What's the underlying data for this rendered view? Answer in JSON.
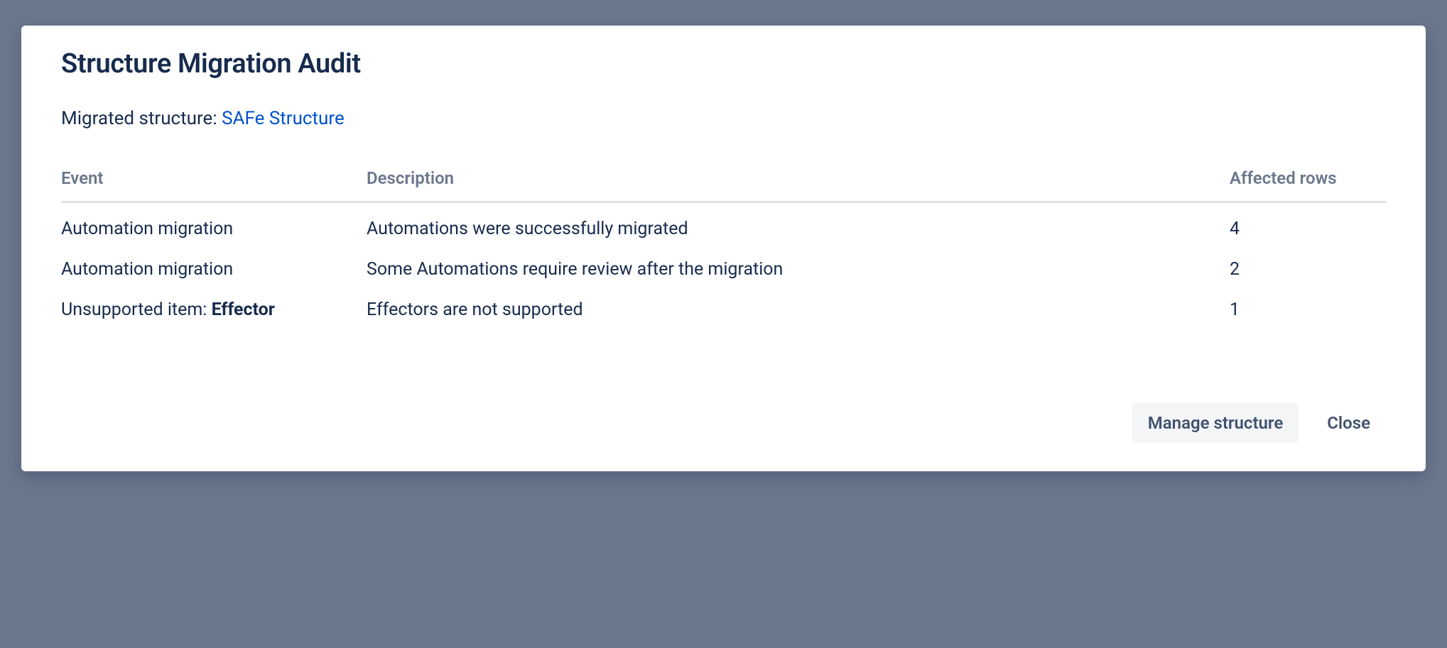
{
  "modal": {
    "title": "Structure Migration Audit",
    "subheading_label": "Migrated structure: ",
    "structure_link_text": "SAFe Structure"
  },
  "table": {
    "headers": {
      "event": "Event",
      "description": "Description",
      "affected": "Affected rows"
    },
    "rows": [
      {
        "event_prefix": "Automation migration",
        "event_bold": "",
        "description": "Automations were successfully migrated",
        "affected": "4"
      },
      {
        "event_prefix": "Automation migration",
        "event_bold": "",
        "description": "Some Automations require review after the migration",
        "affected": "2"
      },
      {
        "event_prefix": "Unsupported item: ",
        "event_bold": "Effector",
        "description": "Effectors are not supported",
        "affected": "1"
      }
    ]
  },
  "footer": {
    "manage_button": "Manage structure",
    "close_button": "Close"
  }
}
